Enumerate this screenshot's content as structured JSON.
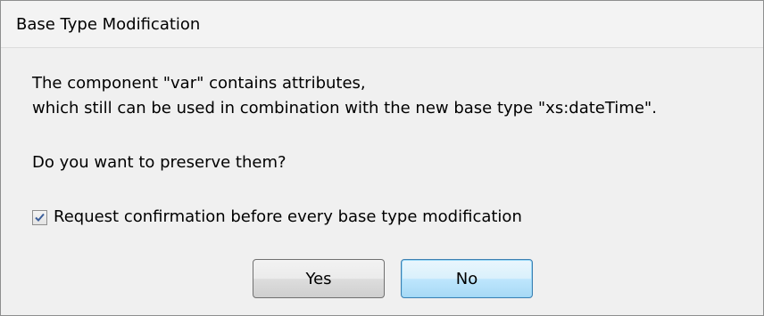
{
  "dialog": {
    "title": "Base Type Modification",
    "message_line_1": "The component \"var\" contains attributes,",
    "message_line_2": "which still can be used in combination with the new base type \"xs:dateTime\".",
    "question": "Do you want to preserve them?",
    "checkbox": {
      "label": "Request confirmation before every base type modification",
      "checked": true
    },
    "buttons": {
      "yes_label": "Yes",
      "no_label": "No"
    }
  },
  "colors": {
    "dialog_background": "#f0f0f0",
    "default_button_border": "#3c7fb1",
    "checkmark": "#3b5e9a"
  },
  "icons": {
    "checkbox_mark": "checkmark-icon"
  }
}
